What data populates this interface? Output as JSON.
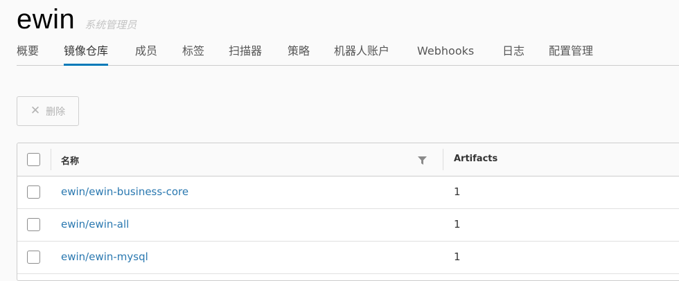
{
  "project": {
    "name": "ewin",
    "role": "系统管理员"
  },
  "tabs": [
    {
      "label": "概要"
    },
    {
      "label": "镜像仓库",
      "active": true
    },
    {
      "label": "成员"
    },
    {
      "label": "标签"
    },
    {
      "label": "扫描器"
    },
    {
      "label": "策略"
    },
    {
      "label": "机器人账户"
    },
    {
      "label": "Webhooks"
    },
    {
      "label": "日志"
    },
    {
      "label": "配置管理"
    }
  ],
  "toolbar": {
    "delete_icon": "close-icon",
    "delete_label": "删除"
  },
  "grid": {
    "columns": {
      "name": "名称",
      "artifacts": "Artifacts"
    },
    "filter_icon": "filter-icon",
    "rows": [
      {
        "name": "ewin/ewin-business-core",
        "artifacts": "1"
      },
      {
        "name": "ewin/ewin-all",
        "artifacts": "1"
      },
      {
        "name": "ewin/ewin-mysql",
        "artifacts": "1"
      }
    ]
  },
  "colors": {
    "accent": "#0079b8",
    "link": "#2a78b0"
  }
}
